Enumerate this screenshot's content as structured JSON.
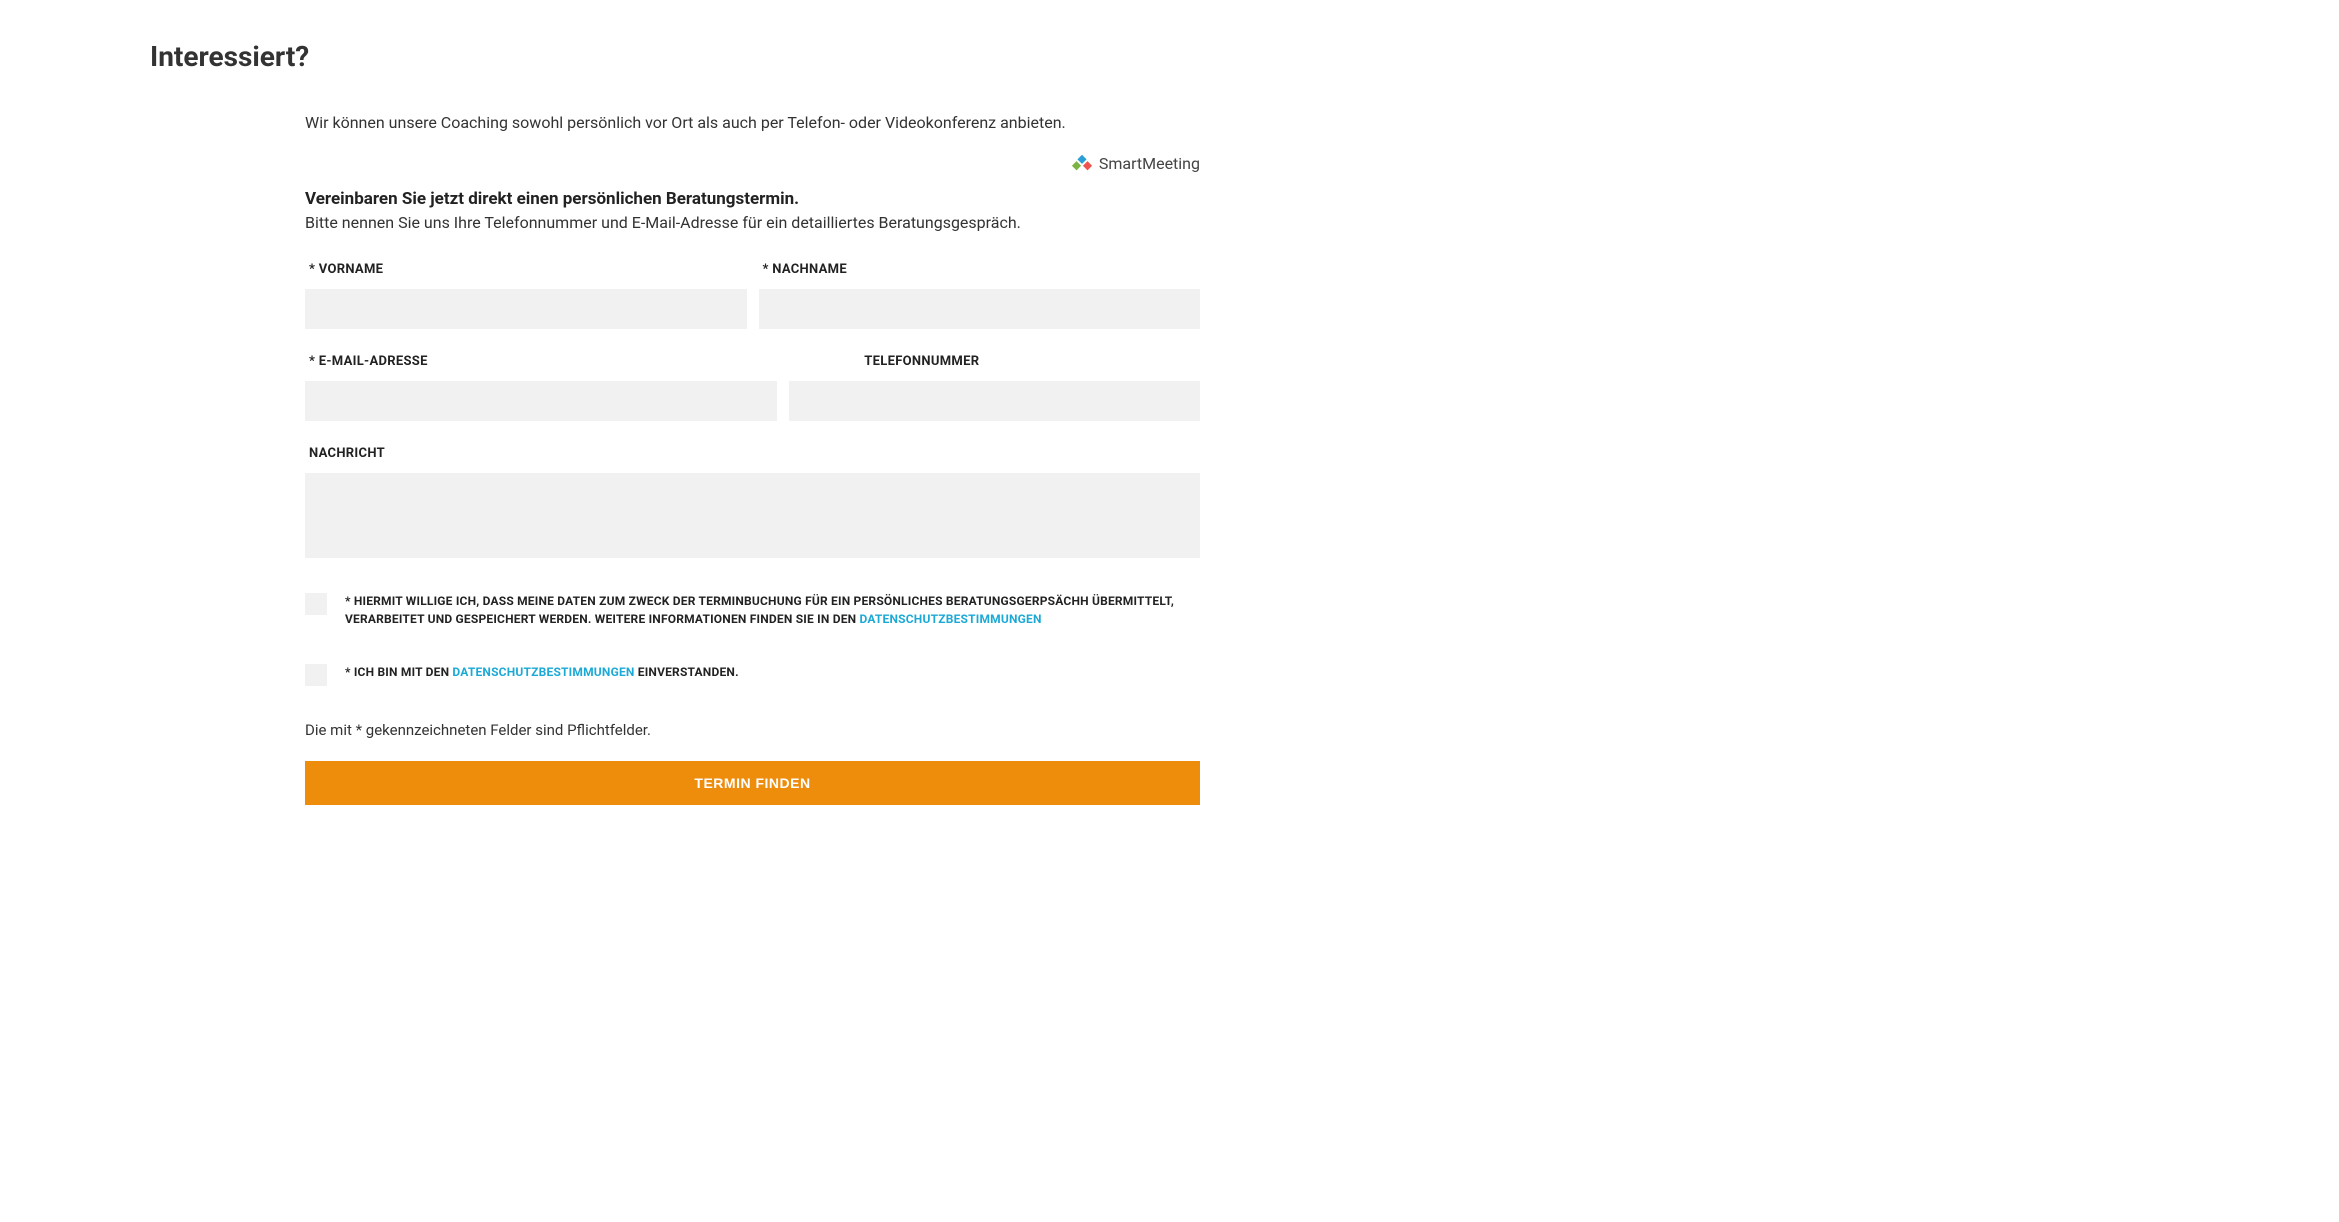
{
  "page": {
    "title": "Interessiert?"
  },
  "intro": {
    "text": "Wir können unsere Coaching sowohl persönlich vor Ort als auch per Telefon- oder Videokonferenz anbieten."
  },
  "brand": {
    "name": "SmartMeeting"
  },
  "subtitle": {
    "bold": "Vereinbaren Sie jetzt direkt einen persönlichen Beratungstermin.",
    "text": "Bitte nennen Sie uns Ihre Telefonnummer und E-Mail-Adresse für ein detailliertes Beratungsgespräch."
  },
  "form": {
    "vorname_label": "* VORNAME",
    "nachname_label": "* NACHNAME",
    "email_label": "* E-MAIL-ADRESSE",
    "telefon_label": "TELEFONNUMMER",
    "nachricht_label": "NACHRICHT",
    "vorname_value": "",
    "nachname_value": "",
    "email_value": "",
    "telefon_value": "",
    "nachricht_value": ""
  },
  "consent1": {
    "prefix": "* HIERMIT WILLIGE ICH, DASS MEINE DATEN ZUM ZWECK DER TERMINBUCHUNG FÜR EIN PERSÖNLICHES BERATUNGSGERPSÄCHH ÜBERMITTELT, VERARBEITET UND GESPEICHERT WERDEN. WEITERE INFORMATIONEN FINDEN SIE IN DEN ",
    "link": "DATENSCHUTZBESTIMMUNGEN"
  },
  "consent2": {
    "prefix": "* ICH BIN MIT DEN ",
    "link": "DATENSCHUTZBESTIMMUNGEN",
    "suffix": " EINVERSTANDEN."
  },
  "required_note": "Die mit * gekennzeichneten Felder sind Pflichtfelder.",
  "submit": {
    "label": "TERMIN FINDEN"
  }
}
